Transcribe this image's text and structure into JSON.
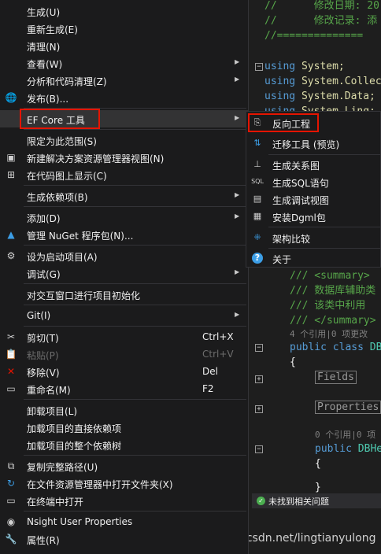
{
  "editor": {
    "lines": [
      {
        "t": "//      修改日期: 20",
        "c": "cm"
      },
      {
        "t": "//      修改记录: 添",
        "c": "cm"
      },
      {
        "t": "//==============",
        "c": "cm"
      }
    ],
    "using": [
      {
        "kw": "using",
        "ns": "System;"
      },
      {
        "kw": "using",
        "ns": "System.Collec"
      },
      {
        "kw": "using",
        "ns": "System.Data;"
      },
      {
        "kw": "using",
        "ns": "System.Linq;"
      }
    ],
    "doc": [
      "/// <summary>",
      "/// 数据库辅助类",
      "/// 该类中利用",
      "/// </summary>"
    ],
    "refs1": "4 个引用|0 项更改",
    "class_kw": "public class",
    "class_name": "DB",
    "brace_open": "{",
    "fields": "Fields",
    "properties": "Properties",
    "refs2": "0 个引用|0 项",
    "ctor_kw": "public",
    "ctor_name": "DBHe",
    "brace2": "{",
    "brace3": "}"
  },
  "statusbar": {
    "text": "未找到相关问题",
    "icon": "check-icon"
  },
  "watermark": "https://blog.csdn.net/lingtianyulong",
  "menu": [
    {
      "label": "生成(U)",
      "icon": ""
    },
    {
      "label": "重新生成(E)",
      "icon": ""
    },
    {
      "label": "清理(N)",
      "icon": ""
    },
    {
      "label": "查看(W)",
      "arrow": "▶"
    },
    {
      "label": "分析和代码清理(Z)",
      "arrow": "▶"
    },
    {
      "label": "发布(B)...",
      "icon": "🌐"
    },
    {
      "label": "EF Core 工具",
      "arrow": "▶"
    },
    {
      "label": "限定为此范围(S)"
    },
    {
      "label": "新建解决方案资源管理器视图(N)",
      "icon": "▣"
    },
    {
      "label": "在代码图上显示(C)",
      "icon": "⊞"
    },
    {
      "label": "生成依赖项(B)",
      "arrow": "▶"
    },
    {
      "label": "添加(D)",
      "arrow": "▶"
    },
    {
      "label": "管理 NuGet 程序包(N)...",
      "icon": "▲"
    },
    {
      "label": "设为启动项目(A)",
      "icon": "⚙"
    },
    {
      "label": "调试(G)",
      "arrow": "▶"
    },
    {
      "label": "对交互窗口进行项目初始化"
    },
    {
      "label": "Git(I)",
      "arrow": "▶"
    },
    {
      "label": "剪切(T)",
      "icon": "✂",
      "shortcut": "Ctrl+X"
    },
    {
      "label": "粘贴(P)",
      "icon": "📋",
      "shortcut": "Ctrl+V"
    },
    {
      "label": "移除(V)",
      "icon": "✕",
      "shortcut": "Del"
    },
    {
      "label": "重命名(M)",
      "icon": "▭",
      "shortcut": "F2"
    },
    {
      "label": "卸载项目(L)"
    },
    {
      "label": "加载项目的直接依赖项"
    },
    {
      "label": "加载项目的整个依赖树"
    },
    {
      "label": "复制完整路径(U)",
      "icon": "⧉"
    },
    {
      "label": "在文件资源管理器中打开文件夹(X)",
      "icon": "↻"
    },
    {
      "label": "在终端中打开",
      "icon": "▭"
    },
    {
      "label": "Nsight User Properties",
      "icon": "◉"
    },
    {
      "label": "属性(R)",
      "icon": "🔧"
    }
  ],
  "submenu": [
    {
      "label": "反向工程",
      "icon": "⎘"
    },
    {
      "label": "迁移工具 (预览)",
      "icon": "⇅"
    },
    {
      "label": "生成关系图",
      "icon": "⊥"
    },
    {
      "label": "生成SQL语句",
      "icon": "SQL"
    },
    {
      "label": "生成调试视图",
      "icon": "▤"
    },
    {
      "label": "安装Dgml包",
      "icon": "▦"
    },
    {
      "label": "架构比较",
      "icon": "⁜"
    },
    {
      "label": "关于",
      "icon": "?"
    }
  ]
}
